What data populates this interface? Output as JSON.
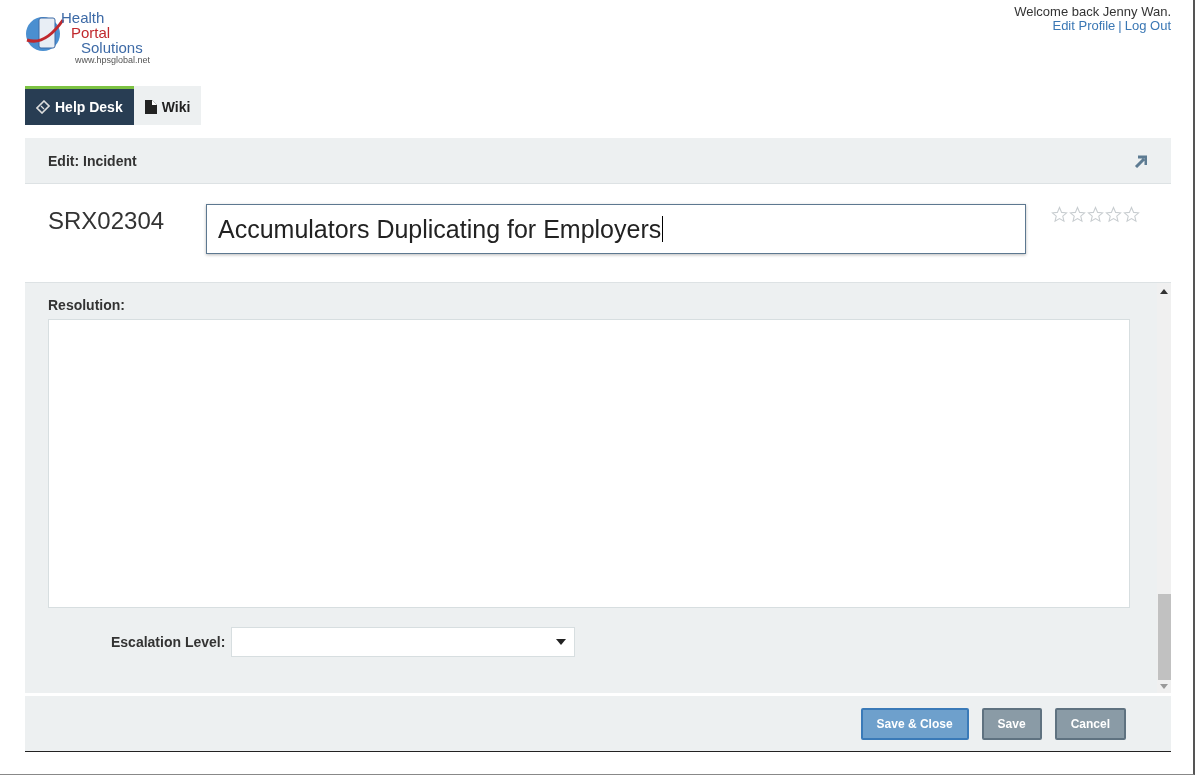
{
  "logo": {
    "lines": [
      "Health",
      "Portal",
      "Solutions"
    ],
    "url": "www.hpsglobal.net"
  },
  "user": {
    "welcome": "Welcome back Jenny Wan.",
    "links": [
      "Edit Profile",
      "Log Out"
    ],
    "separator": "|"
  },
  "tabs": [
    {
      "label": "Help Desk",
      "kind": "ticket",
      "selected": true
    },
    {
      "label": "Wiki",
      "kind": "file",
      "selected": false
    }
  ],
  "header": {
    "title": "Edit: Incident"
  },
  "incident": {
    "id": "SRX02304",
    "title": "Accumulators Duplicating for Employers",
    "stars": 0
  },
  "form": {
    "resolution_label": "Resolution:",
    "escalation_label": "Escalation Level:"
  },
  "buttons": [
    {
      "label": "Save & Close",
      "kind": "primary"
    },
    {
      "label": "Save",
      "kind": "secondary"
    },
    {
      "label": "Cancel",
      "kind": "secondary"
    }
  ]
}
